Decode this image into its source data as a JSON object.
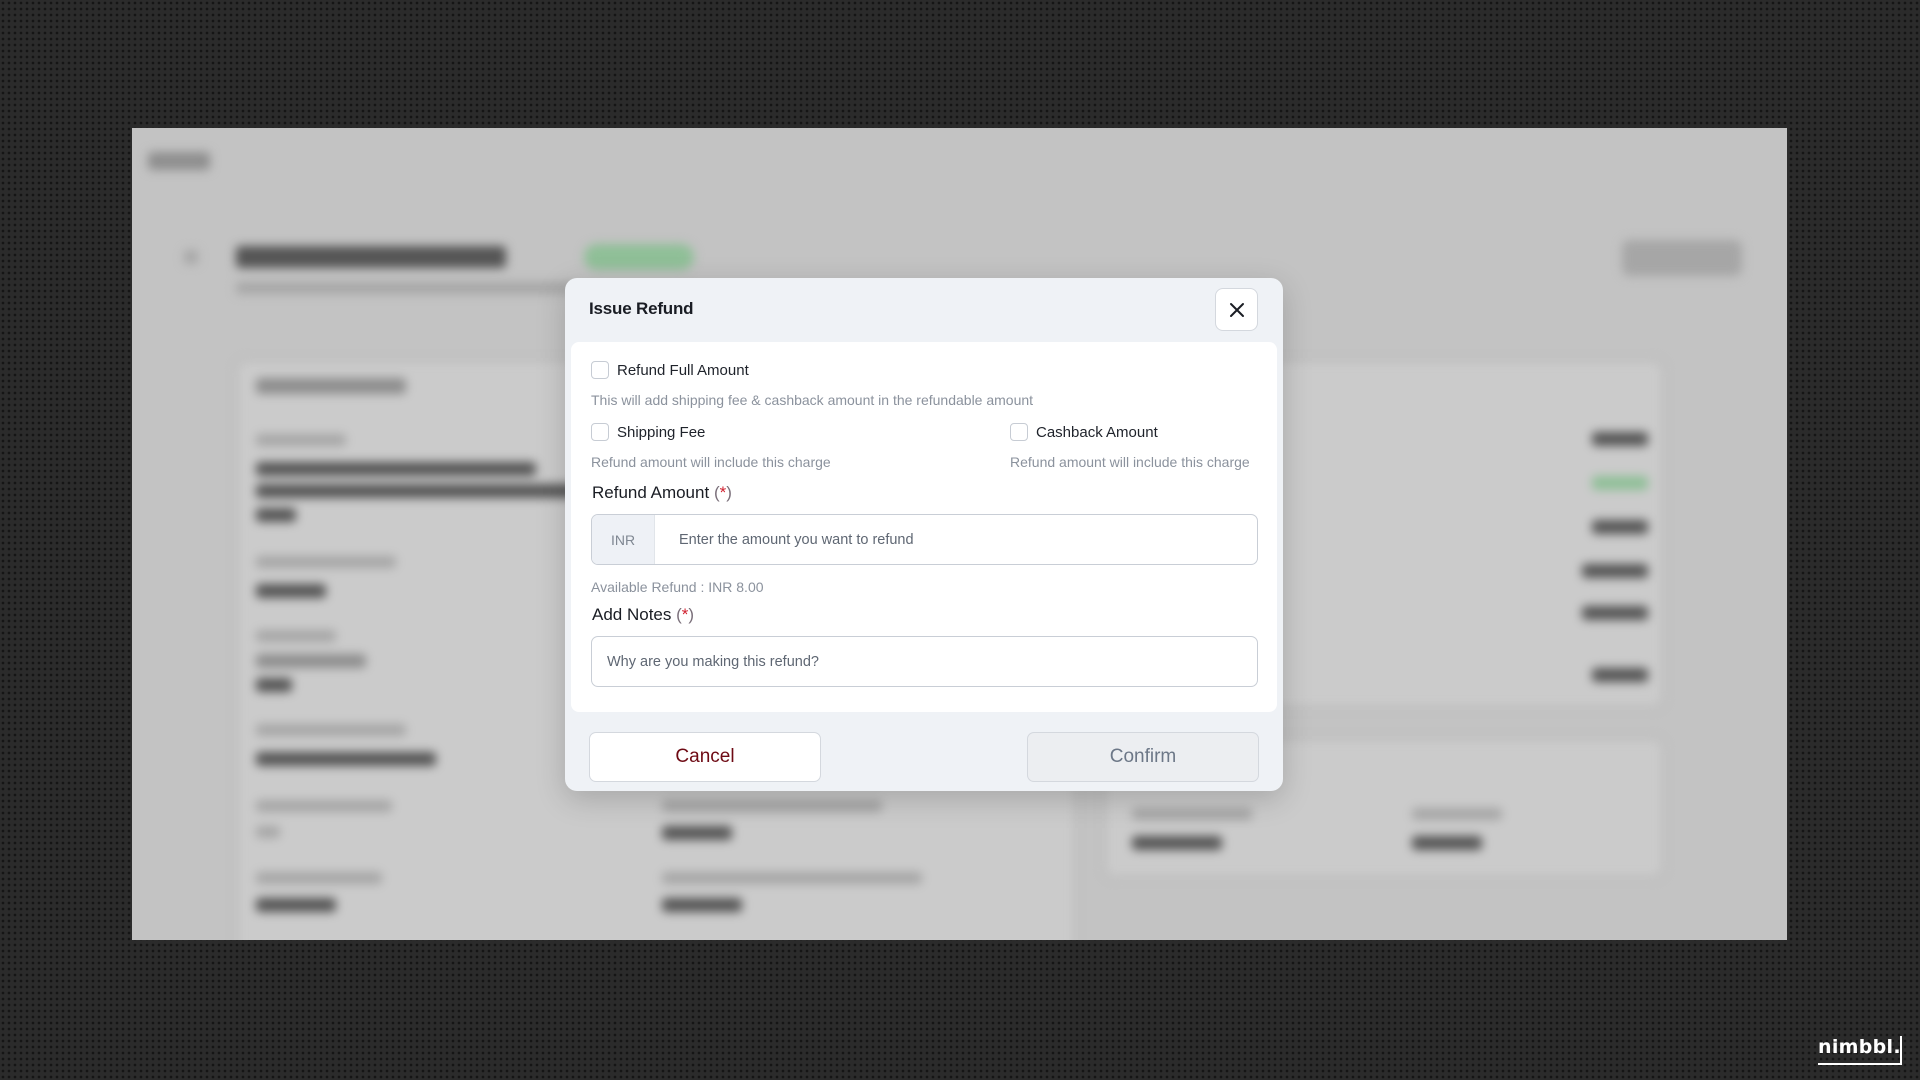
{
  "modal": {
    "title": "Issue Refund",
    "refund_full": {
      "label": "Refund Full Amount",
      "hint": "This will add shipping fee & cashback amount in the refundable amount"
    },
    "shipping_fee": {
      "label": "Shipping Fee",
      "hint": "Refund amount will include this charge"
    },
    "cashback_amount": {
      "label": "Cashback Amount",
      "hint": "Refund amount will include this charge"
    },
    "refund_amount": {
      "label": "Refund Amount",
      "required_mark": "*",
      "currency": "INR",
      "placeholder": "Enter the amount you want to refund",
      "available": "Available Refund : INR 8.00"
    },
    "notes": {
      "label": "Add Notes",
      "required_mark": "*",
      "placeholder": "Why are you making this refund?"
    },
    "cancel_label": "Cancel",
    "confirm_label": "Confirm"
  },
  "brand": {
    "logo_text": "nimbbl."
  },
  "colors": {
    "required": "#d01f2e",
    "cancel_text": "#6e0a14",
    "overlay": "#c3c3c3"
  }
}
